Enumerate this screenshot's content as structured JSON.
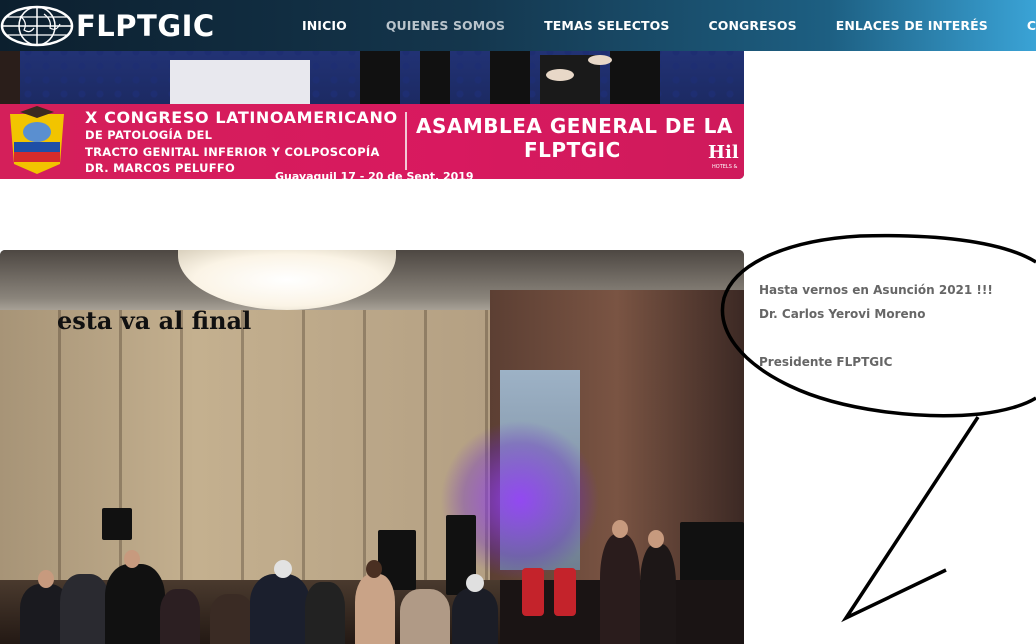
{
  "header": {
    "logo_text": "FLPTGIC",
    "nav": [
      {
        "label": "INICIO",
        "active": false
      },
      {
        "label": "QUIENES SOMOS",
        "active": true
      },
      {
        "label": "TEMAS SELECTOS",
        "active": false
      },
      {
        "label": "CONGRESOS",
        "active": false
      },
      {
        "label": "ENLACES DE INTERÉS",
        "active": false
      },
      {
        "label": "CONTAC",
        "active": false
      }
    ]
  },
  "banner": {
    "line1": "X CONGRESO LATINOAMERICANO",
    "line2": "DE PATOLOGÍA DEL",
    "line3": "TRACTO GENITAL INFERIOR Y COLPOSCOPÍA",
    "line4": "DR. MARCOS PELUFFO",
    "date": "Guayaquil 17 - 20 de Sept. 2019",
    "right_line1": "ASAMBLEA GENERAL DE LA",
    "right_line2": "FLPTGIC",
    "hotel": "Hil",
    "hotel_sub": "HOTELS &"
  },
  "ballroom": {
    "caption": "esta va al final"
  },
  "side": {
    "line1": "Hasta vernos en Asunción 2021 !!!",
    "line2": "Dr. Carlos Yerovi Moreno",
    "line3": "Presidente FLPTGIC"
  },
  "colors": {
    "header_dark": "#0c1f2e",
    "header_light": "#3aa3d6",
    "banner_pink": "#d41f5a",
    "side_text": "#666666",
    "nav_active": "#b9c4cc"
  },
  "icons": [
    "globe-logo-icon",
    "ecuador-flag-emblem-icon",
    "speech-bubble-annotation"
  ]
}
